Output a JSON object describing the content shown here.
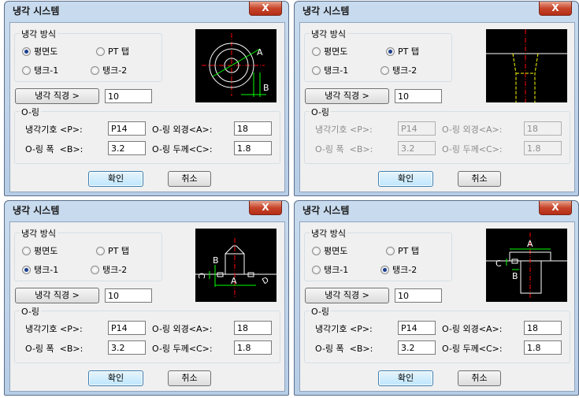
{
  "dialogs": [
    {
      "title": "냉각 시스템",
      "close": "X",
      "method_group": "냉각 방식",
      "options": [
        "평면도",
        "PT 탭",
        "탱크-1",
        "탱크-2"
      ],
      "selected": 0,
      "diameter_button": "냉각 직경 >",
      "diameter_value": "10",
      "oring_group": "O-링",
      "symbol_label": "냉각기호 <P>:",
      "symbol_value": "P14",
      "outer_label": "O-링 외경<A>:",
      "outer_value": "18",
      "width_label": "O-링 폭  <B>:",
      "width_value": "3.2",
      "thick_label": "O-링 두께<C>:",
      "thick_value": "1.8",
      "ok": "확인",
      "cancel": "취소",
      "oring_enabled": true
    },
    {
      "title": "냉각 시스템",
      "close": "X",
      "method_group": "냉각 방식",
      "options": [
        "평면도",
        "PT 탭",
        "탱크-1",
        "탱크-2"
      ],
      "selected": 1,
      "diameter_button": "냉각 직경 >",
      "diameter_value": "10",
      "oring_group": "O-링",
      "symbol_label": "냉각기호 <P>:",
      "symbol_value": "P14",
      "outer_label": "O-링 외경<A>:",
      "outer_value": "18",
      "width_label": "O-링 폭  <B>:",
      "width_value": "3.2",
      "thick_label": "O-링 두께<C>:",
      "thick_value": "1.8",
      "ok": "확인",
      "cancel": "취소",
      "oring_enabled": false
    },
    {
      "title": "냉각 시스템",
      "close": "X",
      "method_group": "냉각 방식",
      "options": [
        "평면도",
        "PT 탭",
        "탱크-1",
        "탱크-2"
      ],
      "selected": 2,
      "diameter_button": "냉각 직경 >",
      "diameter_value": "10",
      "oring_group": "O-링",
      "symbol_label": "냉각기호 <P>:",
      "symbol_value": "P14",
      "outer_label": "O-링 외경<A>:",
      "outer_value": "18",
      "width_label": "O-링 폭  <B>:",
      "width_value": "3.2",
      "thick_label": "O-링 두께<C>:",
      "thick_value": "1.8",
      "ok": "확인",
      "cancel": "취소",
      "oring_enabled": true
    },
    {
      "title": "냉각 시스템",
      "close": "X",
      "method_group": "냉각 방식",
      "options": [
        "평면도",
        "PT 탭",
        "탱크-1",
        "탱크-2"
      ],
      "selected": 3,
      "diameter_button": "냉각 직경 >",
      "diameter_value": "10",
      "oring_group": "O-링",
      "symbol_label": "냉각기호 <P>:",
      "symbol_value": "P14",
      "outer_label": "O-링 외경<A>:",
      "outer_value": "18",
      "width_label": "O-링 폭  <B>:",
      "width_value": "3.2",
      "thick_label": "O-링 두께<C>:",
      "thick_value": "1.8",
      "ok": "확인",
      "cancel": "취소",
      "oring_enabled": true
    }
  ],
  "diagram_labels": {
    "plan": [
      "A",
      "B"
    ],
    "tank1": [
      "B",
      "C",
      "A",
      "D"
    ],
    "tank2": [
      "A",
      "C",
      "B"
    ]
  },
  "colors": {
    "titlebar": "#c9dbee",
    "close": "#c7452b",
    "default_button": "#bee6fd",
    "centerline": "#ff0000",
    "dimension": "#00ff00",
    "outline": "#ffffff",
    "hidden": "#ffff00"
  }
}
